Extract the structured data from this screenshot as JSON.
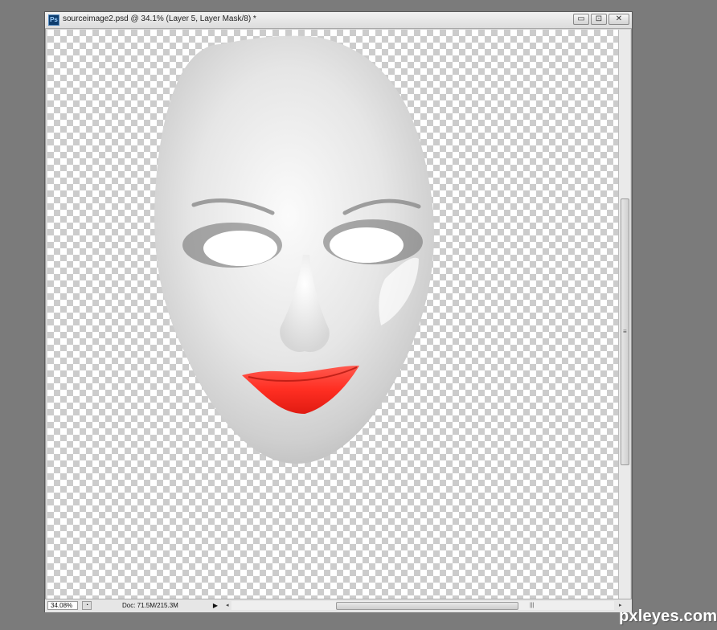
{
  "window": {
    "app_icon": "photoshop-icon",
    "app_icon_text": "Ps",
    "title": "sourceimage2.psd @ 34.1% (Layer 5, Layer Mask/8) *",
    "minimize_glyph": "▭",
    "maximize_glyph": "⊡",
    "close_glyph": "✕"
  },
  "status": {
    "zoom": "34.08%",
    "doc_info": "Doc: 71.5M/215.3M",
    "menu_arrow": "▶",
    "scroll_left": "◂",
    "scroll_right": "▸",
    "grip": "|||"
  },
  "watermark": "pxleyes.com",
  "colors": {
    "lips": "#ff3b30",
    "mask_face": "#e4e4e4",
    "background": "#7b7b7b"
  }
}
